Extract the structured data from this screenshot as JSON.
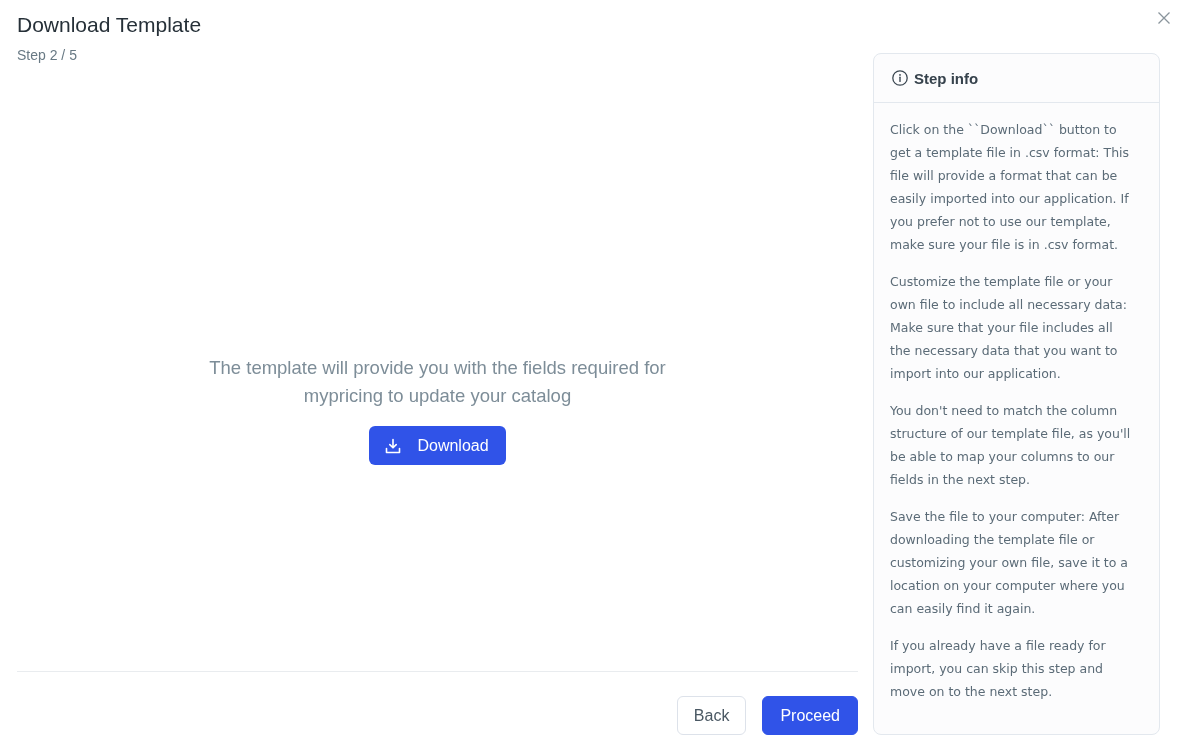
{
  "dialog": {
    "title": "Download Template",
    "step": "Step 2 / 5"
  },
  "content": {
    "message": "The template will provide you with the fields required for mypricing to update your catalog",
    "download_button": "Download"
  },
  "footer": {
    "buttons": [
      {
        "label": "Back",
        "kind": "secondary"
      },
      {
        "label": "Proceed",
        "kind": "primary"
      }
    ]
  },
  "step_info": {
    "title": "Step info",
    "paragraphs": [
      "Click on the ``Download`` button to get a template file in .csv format: This file will provide a format that can be easily imported into our application. If you prefer not to use our template, make sure your file is in .csv format.",
      "Customize the template file or your own file to include all necessary data: Make sure that your file includes all the necessary data that you want to import into our application.",
      "You don't need to match the column structure of our template file, as you'll be able to map your columns to our fields in the next step.",
      "Save the file to your computer: After downloading the template file or customizing your own file, save it to a location on your computer where you can easily find it again.",
      "If you already have a file ready for import, you can skip this step and move on to the next step."
    ]
  }
}
